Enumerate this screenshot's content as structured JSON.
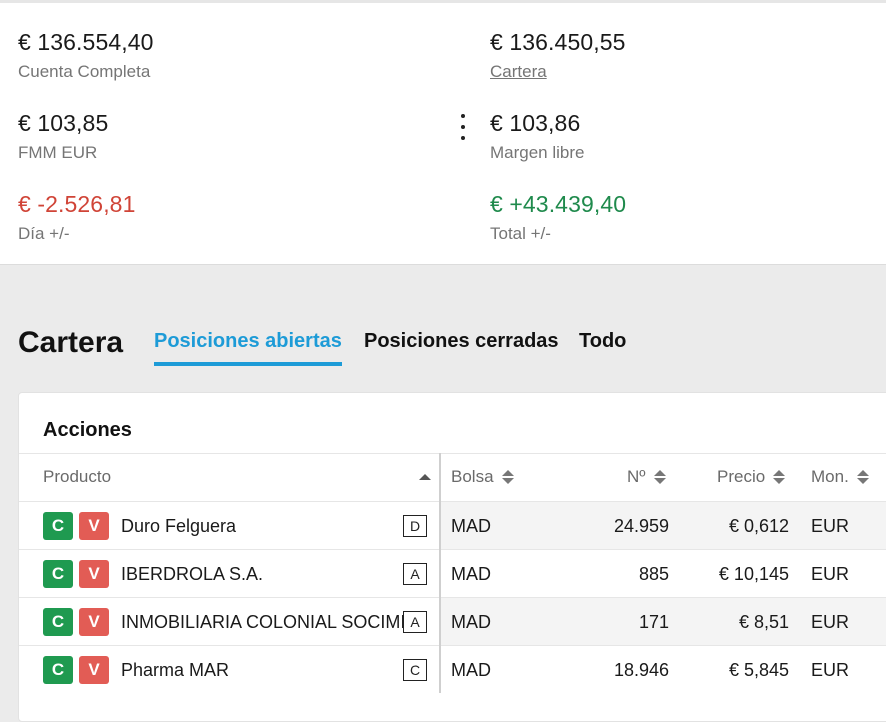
{
  "summary": {
    "full_account": {
      "value": "€ 136.554,40",
      "label": "Cuenta Completa"
    },
    "portfolio": {
      "value": "€ 136.450,55",
      "label": "Cartera"
    },
    "fmm": {
      "value": "€ 103,85",
      "label": "FMM EUR"
    },
    "free_margin": {
      "value": "€ 103,86",
      "label": "Margen libre"
    },
    "day_change": {
      "value": "€ -2.526,81",
      "label": "Día +/-"
    },
    "total_change": {
      "value": "€ +43.439,40",
      "label": "Total +/-"
    }
  },
  "portfolio": {
    "title": "Cartera",
    "tabs": [
      "Posiciones abiertas",
      "Posiciones cerradas",
      "Todo"
    ],
    "active_tab": "Posiciones abiertas"
  },
  "table": {
    "section_title": "Acciones",
    "columns": {
      "product": "Producto",
      "exchange": "Bolsa",
      "quantity": "Nº",
      "price": "Precio",
      "currency": "Mon."
    },
    "buy_label": "C",
    "sell_label": "V",
    "rows": [
      {
        "product": "Duro Felguera",
        "badge": "D",
        "exchange": "MAD",
        "quantity": "24.959",
        "price": "€ 0,612",
        "currency": "EUR"
      },
      {
        "product": "IBERDROLA S.A.",
        "badge": "A",
        "exchange": "MAD",
        "quantity": "885",
        "price": "€ 10,145",
        "currency": "EUR"
      },
      {
        "product": "INMOBILIARIA COLONIAL SOCIMI",
        "badge": "A",
        "exchange": "MAD",
        "quantity": "171",
        "price": "€ 8,51",
        "currency": "EUR"
      },
      {
        "product": "Pharma MAR",
        "badge": "C",
        "exchange": "MAD",
        "quantity": "18.946",
        "price": "€ 5,845",
        "currency": "EUR"
      }
    ]
  },
  "colors": {
    "accent": "#1d9bd7",
    "negative": "#d04437",
    "positive": "#1f8a4c",
    "buy": "#1f9a50",
    "sell": "#e25c55"
  },
  "icons": [
    "more-vertical-icon",
    "sort-asc-icon",
    "sort-both-icon"
  ]
}
